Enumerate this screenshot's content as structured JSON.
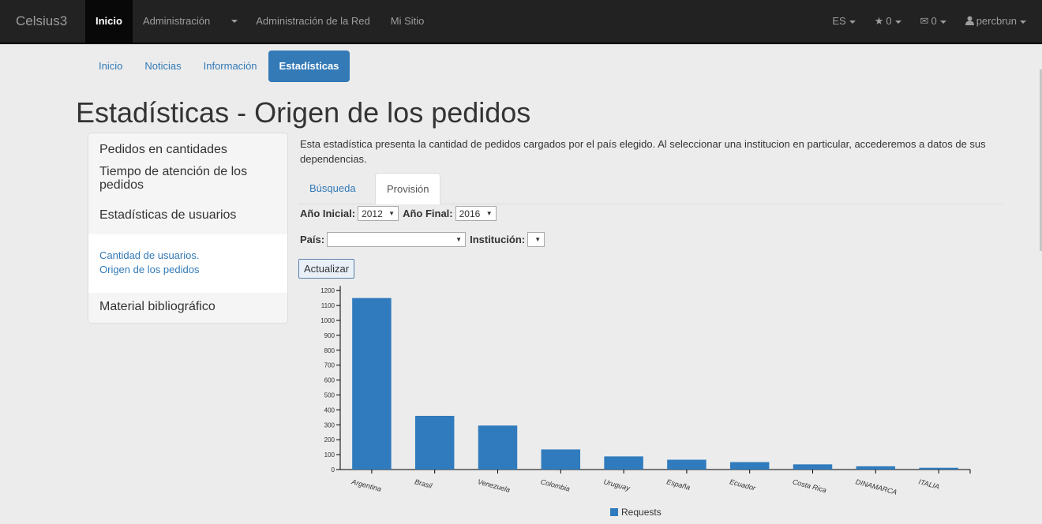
{
  "navbar": {
    "brand": "Celsius3",
    "left_items": [
      "Inicio",
      "Administración",
      "Administración de la Red",
      "Mi Sitio"
    ],
    "lang": "ES",
    "star_count": "0",
    "mail_count": "0",
    "user": "percbrun"
  },
  "subnav": {
    "items": [
      "Inicio",
      "Noticias",
      "Información",
      "Estadísticas"
    ],
    "active": "Estadísticas"
  },
  "page_title": "Estadísticas - Origen de los pedidos",
  "sidebar": {
    "items": [
      "Pedidos en cantidades",
      "Tiempo de atención de los pedidos",
      "Estadísticas de usuarios"
    ],
    "sub_links": [
      "Cantidad de usuarios.",
      "Origen de los pedidos"
    ],
    "last_item": "Material bibliográfico"
  },
  "description": "Esta estadística presenta la cantidad de pedidos cargados por el país elegido. Al seleccionar una institucion en particular, accederemos a datos de sus dependencias.",
  "tabs": [
    "Búsqueda",
    "Provisión"
  ],
  "form": {
    "start_year_label": "Año Inicial:",
    "start_year": "2012",
    "end_year_label": "Año Final:",
    "end_year": "2016",
    "country_label": "País:",
    "country": "",
    "institution_label": "Institución:",
    "institution": "",
    "update_button": "Actualizar"
  },
  "colors": {
    "bar": "#2f7bbd",
    "navbar": "#222222",
    "accent": "#337ab7"
  },
  "chart_data": {
    "type": "bar",
    "categories": [
      "Argentina",
      "Brasil",
      "Venezuela",
      "Colombia",
      "Uruguay",
      "España",
      "Ecuador",
      "Costa Rica",
      "DINAMARCA",
      "ITALIA"
    ],
    "series": [
      {
        "name": "Requests",
        "values": [
          1150,
          360,
          295,
          135,
          88,
          66,
          50,
          35,
          22,
          12
        ]
      }
    ],
    "ylim": [
      0,
      1270
    ],
    "yticks": [
      0,
      100,
      200,
      300,
      400,
      500,
      600,
      700,
      800,
      900,
      1000,
      1100,
      1200
    ],
    "legend": "bottom"
  }
}
